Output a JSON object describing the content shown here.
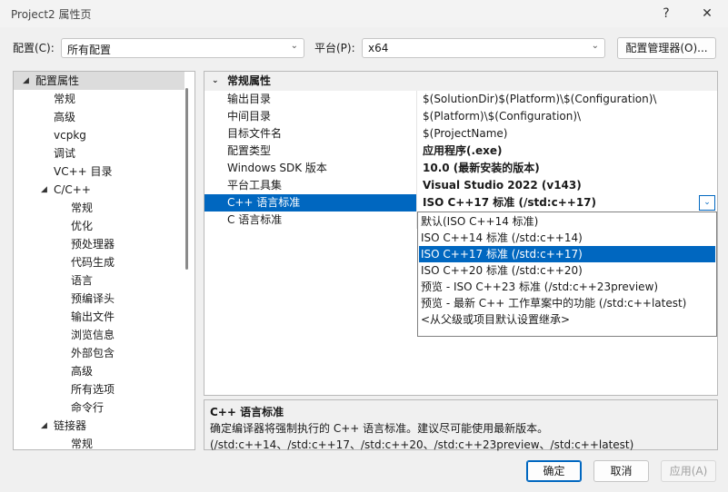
{
  "window": {
    "title": "Project2 属性页",
    "help": "?",
    "close": "✕"
  },
  "config_row": {
    "config_label": "配置(C):",
    "config_value": "所有配置",
    "platform_label": "平台(P):",
    "platform_value": "x64",
    "manager_button": "配置管理器(O)..."
  },
  "tree": {
    "items": [
      {
        "label": "配置属性",
        "level": 0,
        "expanded": true,
        "selected": true
      },
      {
        "label": "常规",
        "level": 1
      },
      {
        "label": "高级",
        "level": 1
      },
      {
        "label": "vcpkg",
        "level": 1
      },
      {
        "label": "调试",
        "level": 1
      },
      {
        "label": "VC++ 目录",
        "level": 1
      },
      {
        "label": "C/C++",
        "level": 1,
        "expanded": true
      },
      {
        "label": "常规",
        "level": 2
      },
      {
        "label": "优化",
        "level": 2
      },
      {
        "label": "预处理器",
        "level": 2
      },
      {
        "label": "代码生成",
        "level": 2
      },
      {
        "label": "语言",
        "level": 2
      },
      {
        "label": "预编译头",
        "level": 2
      },
      {
        "label": "输出文件",
        "level": 2
      },
      {
        "label": "浏览信息",
        "level": 2
      },
      {
        "label": "外部包含",
        "level": 2
      },
      {
        "label": "高级",
        "level": 2
      },
      {
        "label": "所有选项",
        "level": 2
      },
      {
        "label": "命令行",
        "level": 2
      },
      {
        "label": "链接器",
        "level": 1,
        "expanded": true
      },
      {
        "label": "常规",
        "level": 2
      }
    ]
  },
  "grid": {
    "section": "常规属性",
    "rows": [
      {
        "name": "输出目录",
        "value": "$(SolutionDir)$(Platform)\\$(Configuration)\\",
        "bold": false
      },
      {
        "name": "中间目录",
        "value": "$(Platform)\\$(Configuration)\\",
        "bold": false
      },
      {
        "name": "目标文件名",
        "value": "$(ProjectName)",
        "bold": false
      },
      {
        "name": "配置类型",
        "value": "应用程序(.exe)",
        "bold": true
      },
      {
        "name": "Windows SDK 版本",
        "value": "10.0 (最新安装的版本)",
        "bold": true
      },
      {
        "name": "平台工具集",
        "value": "Visual Studio 2022 (v143)",
        "bold": true
      },
      {
        "name": "C++ 语言标准",
        "value": "ISO C++17 标准 (/std:c++17)",
        "bold": true,
        "selected": true
      },
      {
        "name": "C 语言标准",
        "value": "",
        "bold": false
      }
    ]
  },
  "dropdown": {
    "options": [
      "默认(ISO C++14 标准)",
      "ISO C++14 标准 (/std:c++14)",
      "ISO C++17 标准 (/std:c++17)",
      "ISO C++20 标准 (/std:c++20)",
      "预览 - ISO C++23 标准 (/std:c++23preview)",
      "预览 - 最新 C++ 工作草案中的功能 (/std:c++latest)",
      "<从父级或项目默认设置继承>"
    ],
    "selected_index": 2
  },
  "description": {
    "title": "C++ 语言标准",
    "text": "确定编译器将强制执行的 C++ 语言标准。建议尽可能使用最新版本。(/std:c++14、/std:c++17、/std:c++20、/std:c++23preview、/std:c++latest)"
  },
  "buttons": {
    "ok": "确定",
    "cancel": "取消",
    "apply": "应用(A)"
  },
  "colors": {
    "accent": "#0067c0",
    "tree_selected": "#dcdcdc"
  }
}
